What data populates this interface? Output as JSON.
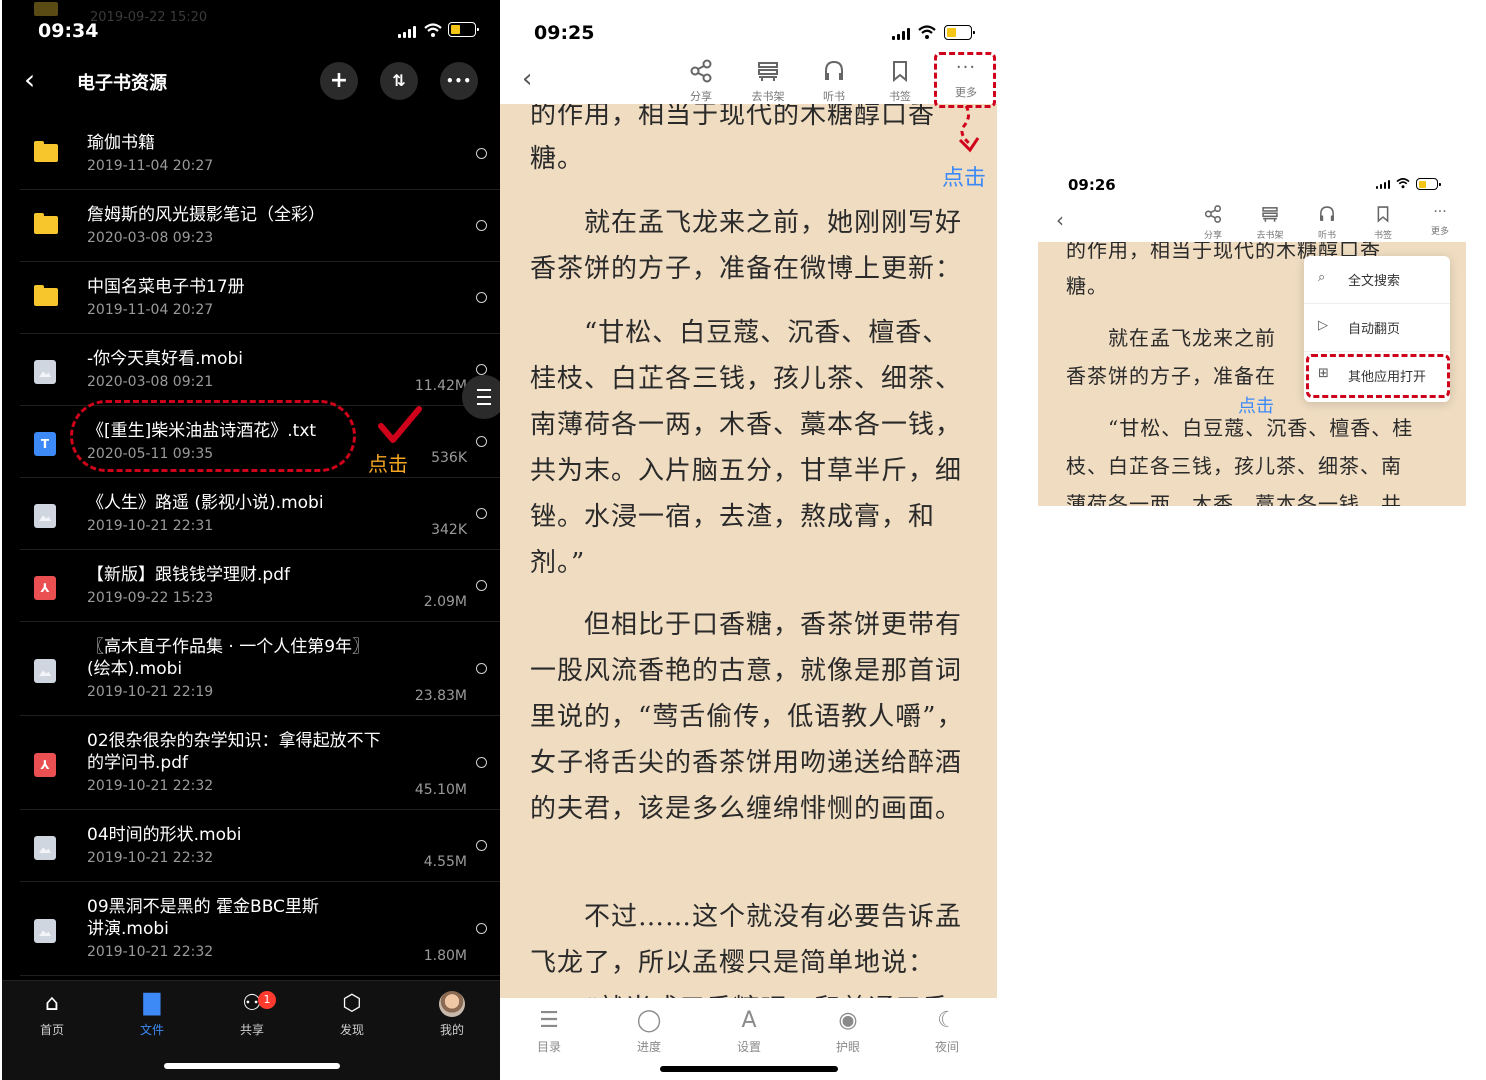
{
  "panel1": {
    "status": {
      "time": "09:34"
    },
    "ghost_date": "2019-09-22 15:20",
    "nav": {
      "back": "‹",
      "title": "电子书资源",
      "add": "+",
      "sort": "⇅",
      "more": "•••"
    },
    "files": [
      {
        "icon": "folder",
        "name": "瑜伽书籍",
        "date": "2019-11-04 20:27",
        "size": ""
      },
      {
        "icon": "folder",
        "name": "詹姆斯的风光摄影笔记（全彩）",
        "date": "2020-03-08 09:23",
        "size": ""
      },
      {
        "icon": "folder",
        "name": "中国名菜电子书17册",
        "date": "2019-11-04 20:27",
        "size": ""
      },
      {
        "icon": "doc",
        "name": "-你今天真好看.mobi",
        "date": "2020-03-08 09:21",
        "size": "11.42M"
      },
      {
        "icon": "txt",
        "name": "《[重生]柴米油盐诗酒花》.txt",
        "date": "2020-05-11 09:35",
        "size": "536K"
      },
      {
        "icon": "doc",
        "name": "《人生》路遥 (影视小说).mobi",
        "date": "2019-10-21 22:31",
        "size": "342K"
      },
      {
        "icon": "pdf",
        "name": "【新版】跟钱钱学理财.pdf",
        "date": "2019-09-22 15:23",
        "size": "2.09M"
      },
      {
        "icon": "doc",
        "name": "〖高木直子作品集 · 一个人住第9年〗",
        "name2": "(绘本).mobi",
        "date": "2019-10-21 22:19",
        "size": "23.83M"
      },
      {
        "icon": "pdf",
        "name": "02很杂很杂的杂学知识：拿得起放不下",
        "name2": "的学问书.pdf",
        "date": "2019-10-21 22:32",
        "size": "45.10M"
      },
      {
        "icon": "doc",
        "name": "04时间的形状.mobi",
        "date": "2019-10-21 22:32",
        "size": "4.55M"
      },
      {
        "icon": "doc",
        "name": "09黑洞不是黑的 霍金BBC里斯",
        "name2": "讲演.mobi",
        "date": "2019-10-21 22:32",
        "size": "1.80M"
      }
    ],
    "annotation": "点击",
    "tabs": [
      {
        "label": "首页",
        "icon": "⌂"
      },
      {
        "label": "文件",
        "icon": "▇"
      },
      {
        "label": "共享",
        "icon": "⚇",
        "badge": "1"
      },
      {
        "label": "发现",
        "icon": "⬡"
      },
      {
        "label": "我的",
        "icon": ""
      }
    ]
  },
  "panel2": {
    "status": {
      "time": "09:25"
    },
    "toolbar": {
      "share": "分享",
      "shelf": "去书架",
      "listen": "听书",
      "bookmark": "书签",
      "more": "更多",
      "more_glyph": "···"
    },
    "annotation": "点击",
    "text": {
      "p0a": "的作用，相当于现代的木糖醇口香",
      "p0b": "糖。",
      "p1": "　　就在孟飞龙来之前，她刚刚写好香茶饼的方子，准备在微博上更新：",
      "p2": "　　“甘松、白豆蔻、沉香、檀香、桂枝、白芷各三钱，孩儿茶、细茶、南薄荷各一两，木香、藁本各一钱，共为末。入片脑五分，甘草半斤，细锉。水浸一宿，去渣，熬成膏，和剂。”",
      "p3": "　　但相比于口香糖，香茶饼更带有一股风流香艳的古意，就像是那首词里说的，“莺舌偷传，低语教人嚼”，女子将舌尖的香茶饼用吻递送给醉酒的夫君，该是多么缠绵悱恻的画面。",
      "p4": "　　不过……这个就没有必要告诉孟飞龙了，所以孟樱只是简单地说：",
      "p5": "　　“就当成口香糖吧，和普通口香"
    },
    "bottom": [
      {
        "label": "目录",
        "icon": "☰"
      },
      {
        "label": "进度",
        "icon": "◯"
      },
      {
        "label": "设置",
        "icon": "A"
      },
      {
        "label": "护眼",
        "icon": "◉"
      },
      {
        "label": "夜间",
        "icon": "☾"
      }
    ]
  },
  "panel3": {
    "status": {
      "time": "09:26"
    },
    "toolbar": {
      "share": "分享",
      "shelf": "去书架",
      "listen": "听书",
      "bookmark": "书签",
      "more": "更多",
      "more_glyph": "···"
    },
    "text": {
      "l1": "的作用，相当于现代的木糖醇口香",
      "l2": "糖。",
      "l3": "　　就在孟飞龙来之前",
      "l4": "香茶饼的方子，准备在",
      "l5": "　　“甘松、白豆蔻、沉香、檀香、桂",
      "l6": "枝、白芷各三钱，孩儿茶、细茶、南",
      "l7": "薄荷各一两，木香、藁本各一钱，共"
    },
    "menu": [
      {
        "label": "全文搜索",
        "icon": "⌕"
      },
      {
        "label": "自动翻页",
        "icon": "▷"
      },
      {
        "label": "其他应用打开",
        "icon": "⊞"
      }
    ],
    "annotation": "点击"
  },
  "colors": {
    "accent_blue": "#3d8af7",
    "annotation_red": "#d0021b",
    "paper": "#efdcc1",
    "folder": "#f7c52c"
  }
}
